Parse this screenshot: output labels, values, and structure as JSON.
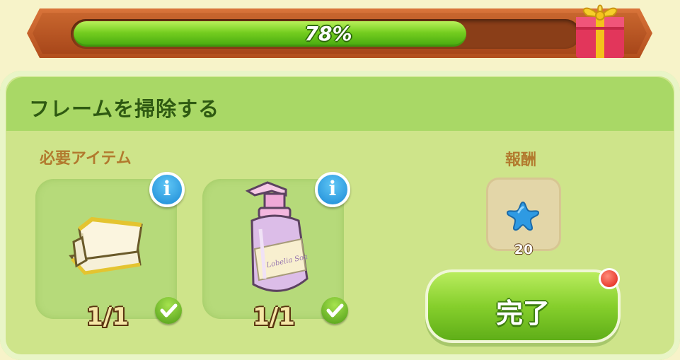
{
  "progress": {
    "percent": 78,
    "label": "78%",
    "fill_color": "#6cc81c"
  },
  "gift": {
    "icon": "gift-box-icon"
  },
  "task": {
    "title": "フレームを掃除する",
    "required_items_label": "必要アイテム",
    "reward_label": "報酬",
    "items": [
      {
        "icon": "towels-icon",
        "count": "1/1",
        "completed": true
      },
      {
        "icon": "soap-bottle-icon",
        "count": "1/1",
        "completed": true,
        "bottle_text": "Lobelia Soa"
      }
    ],
    "reward": {
      "icon": "blue-star-icon",
      "value": "20"
    },
    "complete_button_label": "完了"
  },
  "colors": {
    "panel": "#cee48a",
    "header": "#a9d866",
    "title": "#2f5a12",
    "section_label": "#b27a2e",
    "notification": "#e01d12"
  }
}
